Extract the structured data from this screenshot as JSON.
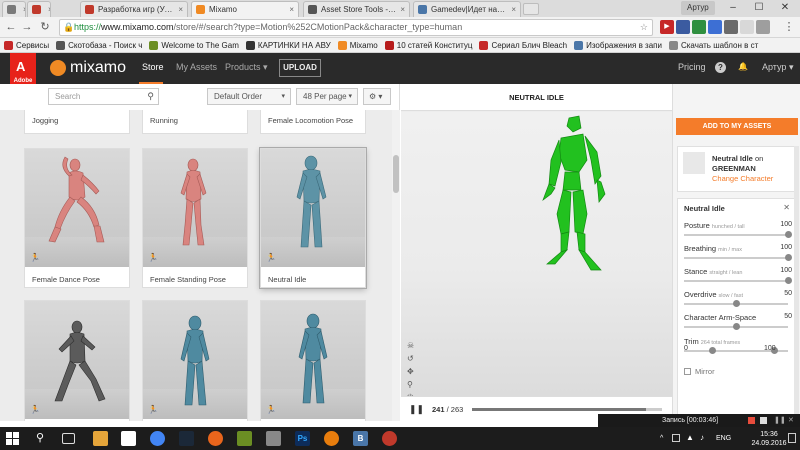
{
  "browser": {
    "tabs": [
      {
        "title": "",
        "color": "#7a7a7a"
      },
      {
        "title": "",
        "color": "#c0392b"
      },
      {
        "title": "Разработка игр (Урок",
        "color": "#c0392b"
      },
      {
        "title": "Mixamo",
        "color": "#f08a24"
      },
      {
        "title": "Asset Store Tools - Asse",
        "color": "#555555"
      },
      {
        "title": "Gamedev|Идет набор в",
        "color": "#4a76a8"
      }
    ],
    "user": "Артур",
    "url_https": "https://",
    "url_host": "www.mixamo.com",
    "url_rest": "/store/#/search?type=Motion%252CMotionPack&character_type=human",
    "bookmarks": [
      {
        "label": "Сервисы",
        "color": "#c62828"
      },
      {
        "label": "Скотобаза - Поиск ч",
        "color": "#555555"
      },
      {
        "label": "Welcome to The Gam",
        "color": "#6b8e23"
      },
      {
        "label": "КАРТИНКИ НА АВУ",
        "color": "#333333"
      },
      {
        "label": "Mixamo",
        "color": "#f08a24"
      },
      {
        "label": "10 статей Конституц",
        "color": "#b71c1c"
      },
      {
        "label": "Сериал Блич Bleach",
        "color": "#c62828"
      },
      {
        "label": "Изображения в запи",
        "color": "#4a76a8"
      },
      {
        "label": "Скачать шаблон в ст",
        "color": "#888888"
      }
    ]
  },
  "header": {
    "adobe": "Adobe",
    "logo": "mixamo",
    "nav": {
      "store": "Store",
      "my_assets": "My Assets",
      "products": "Products ▾"
    },
    "upload": "UPLOAD",
    "pricing": "Pricing",
    "help": "?",
    "bell": "🔔",
    "user": "Артур ▾"
  },
  "toolbar": {
    "search_placeholder": "Search",
    "sort": "Default Order",
    "per_page": "48 Per page",
    "settings": "⚙ ▾"
  },
  "grid": {
    "top_labels": [
      "Jogging",
      "Running",
      "Female Locomotion Pose"
    ],
    "cards": [
      {
        "label": "Female Dance Pose",
        "color": "#d9847f"
      },
      {
        "label": "Female Standing Pose",
        "color": "#d9847f"
      },
      {
        "label": "Neutral Idle",
        "color": "#5d93a6"
      },
      {
        "label": "",
        "color": "#5b5b5b"
      },
      {
        "label": "",
        "color": "#4f8aa0"
      },
      {
        "label": "",
        "color": "#4f8aa0"
      }
    ]
  },
  "viewer": {
    "title": "NEUTRAL IDLE",
    "frame_current": "241",
    "frame_total": "/ 263",
    "progress": 0.916,
    "icons": [
      "skull-icon",
      "undo-icon",
      "move-icon",
      "zoom-icon",
      "power-icon",
      "camera-icon"
    ],
    "model_color": "#22c11f"
  },
  "side": {
    "add_button": "ADD TO MY ASSETS",
    "anim_name": "Neutral Idle",
    "on": "on",
    "character": "GREENMAN",
    "change": "Change Character",
    "params_title": "Neutral Idle",
    "params": [
      {
        "label": "Posture",
        "hint": "hunched / tall",
        "value": "100",
        "fraction": 1.0
      },
      {
        "label": "Breathing",
        "hint": "min / max",
        "value": "100",
        "fraction": 1.0
      },
      {
        "label": "Stance",
        "hint": "straight / lean",
        "value": "100",
        "fraction": 1.0
      },
      {
        "label": "Overdrive",
        "hint": "slow / fast",
        "value": "50",
        "fraction": 0.5
      },
      {
        "label": "Character Arm-Space",
        "hint": "",
        "value": "50",
        "fraction": 0.5
      }
    ],
    "trim": {
      "label": "Trim",
      "hint": "264 total frames",
      "min": "0",
      "max": "100",
      "start": 0.27,
      "end": 0.87
    },
    "mirror": "Mirror"
  },
  "recording": {
    "text": "Запись [00:03:46]"
  },
  "taskbar": {
    "lang": "ENG",
    "time": "15:36",
    "date": "24.09.2016"
  }
}
